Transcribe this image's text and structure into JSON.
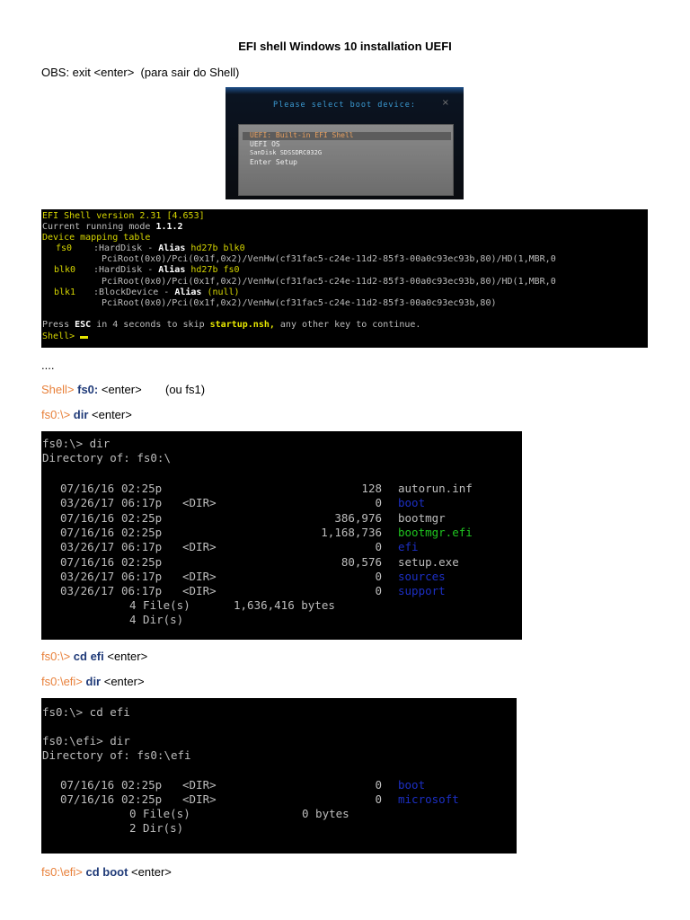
{
  "title": "EFI shell Windows 10 installation UEFI",
  "obs": "OBS: exit <enter>  (para sair do Shell)",
  "boot_menu": {
    "header": "Please select boot device:",
    "close": "×",
    "items": [
      "UEFI: Built-in EFI Shell",
      "UEFI OS",
      "SanDisk SDSSDRC032G",
      "Enter Setup"
    ]
  },
  "shell_screen": {
    "version": "EFI Shell version 2.31 [4.653]",
    "mode_label": "Current running mode ",
    "mode": "1.1.2",
    "mapping": "Device mapping table",
    "devices": [
      {
        "name": "fs0",
        "type": ":HardDisk - ",
        "alias_label": "Alias",
        "alias": "hd27b blk0",
        "path": "PciRoot(0x0)/Pci(0x1f,0x2)/VenHw(cf31fac5-c24e-11d2-85f3-00a0c93ec93b,80)/HD(1,MBR,0"
      },
      {
        "name": "blk0",
        "type": ":HardDisk - ",
        "alias_label": "Alias",
        "alias": "hd27b fs0",
        "path": "PciRoot(0x0)/Pci(0x1f,0x2)/VenHw(cf31fac5-c24e-11d2-85f3-00a0c93ec93b,80)/HD(1,MBR,0"
      },
      {
        "name": "blk1",
        "type": ":BlockDevice - ",
        "alias_label": "Alias",
        "alias": "(null)",
        "path": "PciRoot(0x0)/Pci(0x1f,0x2)/VenHw(cf31fac5-c24e-11d2-85f3-00a0c93ec93b,80)"
      }
    ],
    "press1": "Press ",
    "esc": "ESC",
    "press2": " in 4 seconds to skip ",
    "startup": "startup.nsh,",
    "press3": " any other key to continue.",
    "prompt": "Shell> "
  },
  "dots": "....",
  "step1": {
    "prompt": "Shell> ",
    "cmd": "fs0:",
    "rest": " <enter>",
    "note": "(ou fs1)"
  },
  "step2": {
    "prompt": "fs0:\\> ",
    "cmd": "dir",
    "rest": " <enter>"
  },
  "dir_screen": {
    "cmd": "fs0:\\> dir",
    "heading": "Directory of: fs0:\\",
    "entries": [
      {
        "date": "07/16/16",
        "time": "02:25p",
        "dir": "",
        "size": "128",
        "name": "autorun.inf"
      },
      {
        "date": "03/26/17",
        "time": "06:17p",
        "dir": "<DIR>",
        "size": "0",
        "name": "boot"
      },
      {
        "date": "07/16/16",
        "time": "02:25p",
        "dir": "",
        "size": "386,976",
        "name": "bootmgr"
      },
      {
        "date": "07/16/16",
        "time": "02:25p",
        "dir": "",
        "size": "1,168,736",
        "name": "bootmgr.efi"
      },
      {
        "date": "03/26/17",
        "time": "06:17p",
        "dir": "<DIR>",
        "size": "0",
        "name": "efi"
      },
      {
        "date": "07/16/16",
        "time": "02:25p",
        "dir": "",
        "size": "80,576",
        "name": "setup.exe"
      },
      {
        "date": "03/26/17",
        "time": "06:17p",
        "dir": "<DIR>",
        "size": "0",
        "name": "sources"
      },
      {
        "date": "03/26/17",
        "time": "06:17p",
        "dir": "<DIR>",
        "size": "0",
        "name": "support"
      }
    ],
    "files": "4 File(s)",
    "bytes": "1,636,416 bytes",
    "dirs": "4 Dir(s)"
  },
  "step3": {
    "prompt": "fs0:\\> ",
    "cmd": "cd efi",
    "rest": " <enter>"
  },
  "step4": {
    "prompt": "fs0:\\efi> ",
    "cmd": "dir",
    "rest": " <enter>"
  },
  "efi_screen": {
    "cmd1": "fs0:\\> cd efi",
    "cmd2": "fs0:\\efi> dir",
    "heading": "Directory of: fs0:\\efi",
    "entries": [
      {
        "date": "07/16/16",
        "time": "02:25p",
        "dir": "<DIR>",
        "size": "0",
        "name": "boot"
      },
      {
        "date": "07/16/16",
        "time": "02:25p",
        "dir": "<DIR>",
        "size": "0",
        "name": "microsoft"
      }
    ],
    "files": "0 File(s)",
    "bytes": "0 bytes",
    "dirs": "2 Dir(s)"
  },
  "step5": {
    "prompt": "fs0:\\efi> ",
    "cmd": "cd boot",
    "rest": " <enter>"
  }
}
